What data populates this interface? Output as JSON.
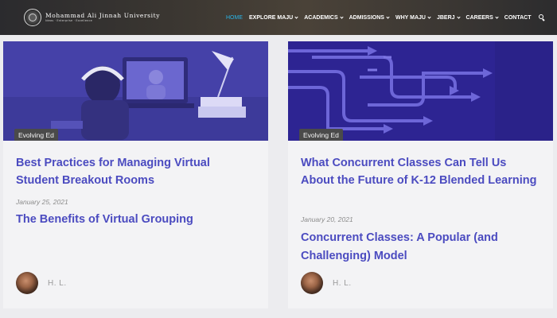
{
  "header": {
    "logo_name": "Mohammad Ali Jinnah University",
    "logo_tagline": "Ideas · Enterprise · Excellence",
    "nav": [
      {
        "label": "HOME",
        "active": true,
        "dropdown": false
      },
      {
        "label": "EXPLORE MAJU",
        "active": false,
        "dropdown": true
      },
      {
        "label": "ACADEMICS",
        "active": false,
        "dropdown": true
      },
      {
        "label": "ADMISSIONS",
        "active": false,
        "dropdown": true
      },
      {
        "label": "WHY MAJU",
        "active": false,
        "dropdown": true
      },
      {
        "label": "JBERJ",
        "active": false,
        "dropdown": true
      },
      {
        "label": "CAREERS",
        "active": false,
        "dropdown": true
      },
      {
        "label": "CONTACT",
        "active": false,
        "dropdown": false
      }
    ],
    "search_icon": "search-icon"
  },
  "colors": {
    "accent_link": "#4b4bc0",
    "nav_active": "#29b5e8",
    "badge_bg": "#4a4a4a"
  },
  "cards": [
    {
      "category": "Evolving Ed",
      "title": "Best Practices for Managing Virtual Student Breakout Rooms",
      "date": "January 25, 2021",
      "subtitle": "The Benefits of Virtual Grouping",
      "author": "H. L."
    },
    {
      "category": "Evolving Ed",
      "title": "What Concurrent Classes Can Tell Us About the Future of K-12 Blended Learning",
      "date": "January 20, 2021",
      "subtitle": "Concurrent Classes: A Popular (and Challenging) Model",
      "author": "H. L."
    }
  ]
}
